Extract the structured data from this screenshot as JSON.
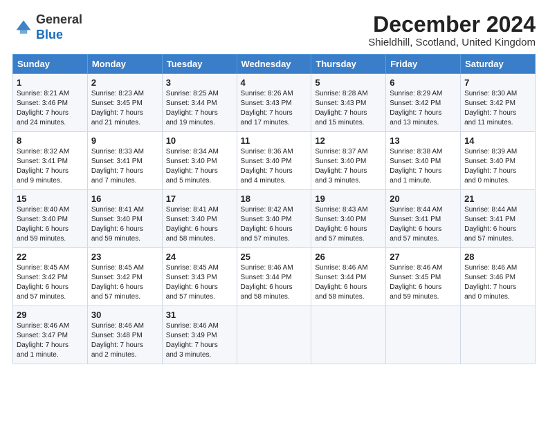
{
  "logo": {
    "line1": "General",
    "line2": "Blue"
  },
  "title": "December 2024",
  "location": "Shieldhill, Scotland, United Kingdom",
  "headers": [
    "Sunday",
    "Monday",
    "Tuesday",
    "Wednesday",
    "Thursday",
    "Friday",
    "Saturday"
  ],
  "weeks": [
    [
      {
        "day": "1",
        "text": "Sunrise: 8:21 AM\nSunset: 3:46 PM\nDaylight: 7 hours\nand 24 minutes."
      },
      {
        "day": "2",
        "text": "Sunrise: 8:23 AM\nSunset: 3:45 PM\nDaylight: 7 hours\nand 21 minutes."
      },
      {
        "day": "3",
        "text": "Sunrise: 8:25 AM\nSunset: 3:44 PM\nDaylight: 7 hours\nand 19 minutes."
      },
      {
        "day": "4",
        "text": "Sunrise: 8:26 AM\nSunset: 3:43 PM\nDaylight: 7 hours\nand 17 minutes."
      },
      {
        "day": "5",
        "text": "Sunrise: 8:28 AM\nSunset: 3:43 PM\nDaylight: 7 hours\nand 15 minutes."
      },
      {
        "day": "6",
        "text": "Sunrise: 8:29 AM\nSunset: 3:42 PM\nDaylight: 7 hours\nand 13 minutes."
      },
      {
        "day": "7",
        "text": "Sunrise: 8:30 AM\nSunset: 3:42 PM\nDaylight: 7 hours\nand 11 minutes."
      }
    ],
    [
      {
        "day": "8",
        "text": "Sunrise: 8:32 AM\nSunset: 3:41 PM\nDaylight: 7 hours\nand 9 minutes."
      },
      {
        "day": "9",
        "text": "Sunrise: 8:33 AM\nSunset: 3:41 PM\nDaylight: 7 hours\nand 7 minutes."
      },
      {
        "day": "10",
        "text": "Sunrise: 8:34 AM\nSunset: 3:40 PM\nDaylight: 7 hours\nand 5 minutes."
      },
      {
        "day": "11",
        "text": "Sunrise: 8:36 AM\nSunset: 3:40 PM\nDaylight: 7 hours\nand 4 minutes."
      },
      {
        "day": "12",
        "text": "Sunrise: 8:37 AM\nSunset: 3:40 PM\nDaylight: 7 hours\nand 3 minutes."
      },
      {
        "day": "13",
        "text": "Sunrise: 8:38 AM\nSunset: 3:40 PM\nDaylight: 7 hours\nand 1 minute."
      },
      {
        "day": "14",
        "text": "Sunrise: 8:39 AM\nSunset: 3:40 PM\nDaylight: 7 hours\nand 0 minutes."
      }
    ],
    [
      {
        "day": "15",
        "text": "Sunrise: 8:40 AM\nSunset: 3:40 PM\nDaylight: 6 hours\nand 59 minutes."
      },
      {
        "day": "16",
        "text": "Sunrise: 8:41 AM\nSunset: 3:40 PM\nDaylight: 6 hours\nand 59 minutes."
      },
      {
        "day": "17",
        "text": "Sunrise: 8:41 AM\nSunset: 3:40 PM\nDaylight: 6 hours\nand 58 minutes."
      },
      {
        "day": "18",
        "text": "Sunrise: 8:42 AM\nSunset: 3:40 PM\nDaylight: 6 hours\nand 57 minutes."
      },
      {
        "day": "19",
        "text": "Sunrise: 8:43 AM\nSunset: 3:40 PM\nDaylight: 6 hours\nand 57 minutes."
      },
      {
        "day": "20",
        "text": "Sunrise: 8:44 AM\nSunset: 3:41 PM\nDaylight: 6 hours\nand 57 minutes."
      },
      {
        "day": "21",
        "text": "Sunrise: 8:44 AM\nSunset: 3:41 PM\nDaylight: 6 hours\nand 57 minutes."
      }
    ],
    [
      {
        "day": "22",
        "text": "Sunrise: 8:45 AM\nSunset: 3:42 PM\nDaylight: 6 hours\nand 57 minutes."
      },
      {
        "day": "23",
        "text": "Sunrise: 8:45 AM\nSunset: 3:42 PM\nDaylight: 6 hours\nand 57 minutes."
      },
      {
        "day": "24",
        "text": "Sunrise: 8:45 AM\nSunset: 3:43 PM\nDaylight: 6 hours\nand 57 minutes."
      },
      {
        "day": "25",
        "text": "Sunrise: 8:46 AM\nSunset: 3:44 PM\nDaylight: 6 hours\nand 58 minutes."
      },
      {
        "day": "26",
        "text": "Sunrise: 8:46 AM\nSunset: 3:44 PM\nDaylight: 6 hours\nand 58 minutes."
      },
      {
        "day": "27",
        "text": "Sunrise: 8:46 AM\nSunset: 3:45 PM\nDaylight: 6 hours\nand 59 minutes."
      },
      {
        "day": "28",
        "text": "Sunrise: 8:46 AM\nSunset: 3:46 PM\nDaylight: 7 hours\nand 0 minutes."
      }
    ],
    [
      {
        "day": "29",
        "text": "Sunrise: 8:46 AM\nSunset: 3:47 PM\nDaylight: 7 hours\nand 1 minute."
      },
      {
        "day": "30",
        "text": "Sunrise: 8:46 AM\nSunset: 3:48 PM\nDaylight: 7 hours\nand 2 minutes."
      },
      {
        "day": "31",
        "text": "Sunrise: 8:46 AM\nSunset: 3:49 PM\nDaylight: 7 hours\nand 3 minutes."
      },
      {
        "day": "",
        "text": ""
      },
      {
        "day": "",
        "text": ""
      },
      {
        "day": "",
        "text": ""
      },
      {
        "day": "",
        "text": ""
      }
    ]
  ]
}
